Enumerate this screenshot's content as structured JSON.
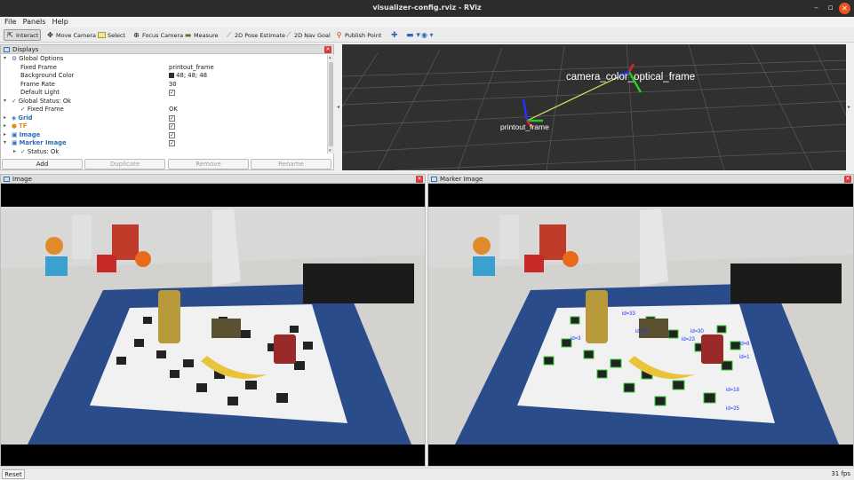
{
  "window": {
    "title": "visualizer-config.rviz - RViz"
  },
  "menu": {
    "items": [
      "File",
      "Panels",
      "Help"
    ]
  },
  "toolbar": {
    "tools": [
      {
        "label": "Interact",
        "icon": "cursor-icon",
        "active": true
      },
      {
        "label": "Move Camera",
        "icon": "move-camera-icon"
      },
      {
        "label": "Select",
        "icon": "select-icon"
      },
      {
        "label": "Focus Camera",
        "icon": "focus-camera-icon"
      },
      {
        "label": "Measure",
        "icon": "measure-icon"
      },
      {
        "label": "2D Pose Estimate",
        "icon": "pose-estimate-icon"
      },
      {
        "label": "2D Nav Goal",
        "icon": "nav-goal-icon"
      },
      {
        "label": "Publish Point",
        "icon": "publish-point-icon"
      }
    ]
  },
  "displays": {
    "title": "Displays",
    "rows": [
      {
        "key": "Global Options",
        "value": "",
        "check": ""
      },
      {
        "key": "Fixed Frame",
        "value": "printout_frame",
        "check": ""
      },
      {
        "key": "Background Color",
        "value": "48; 48; 48",
        "check": ""
      },
      {
        "key": "Frame Rate",
        "value": "30",
        "check": ""
      },
      {
        "key": "Default Light",
        "value": "",
        "check": "✓"
      },
      {
        "key": "Global Status: Ok",
        "value": "",
        "check": ""
      },
      {
        "key": "Fixed Frame",
        "value": "OK",
        "check": ""
      },
      {
        "key": "Grid",
        "value": "",
        "check": "✓"
      },
      {
        "key": "TF",
        "value": "",
        "check": "✓"
      },
      {
        "key": "Image",
        "value": "",
        "check": "✓"
      },
      {
        "key": "Marker Image",
        "value": "",
        "check": "✓"
      },
      {
        "key": "Status: Ok",
        "value": "",
        "check": ""
      }
    ],
    "buttons": {
      "add": "Add",
      "duplicate": "Duplicate",
      "remove": "Remove",
      "rename": "Rename"
    }
  },
  "view3d": {
    "background_color": "#303030",
    "labels": {
      "camera": "camera_color_optical_frame",
      "printout": "printout_frame"
    }
  },
  "panels": {
    "image_title": "Image",
    "marker_title": "Marker Image"
  },
  "markers": [
    "id=33",
    "id=3",
    "id=23",
    "id=30",
    "id=30",
    "id=8",
    "id=1",
    "id=18",
    "id=25"
  ],
  "status": {
    "reset": "Reset",
    "fps": "31 fps"
  }
}
